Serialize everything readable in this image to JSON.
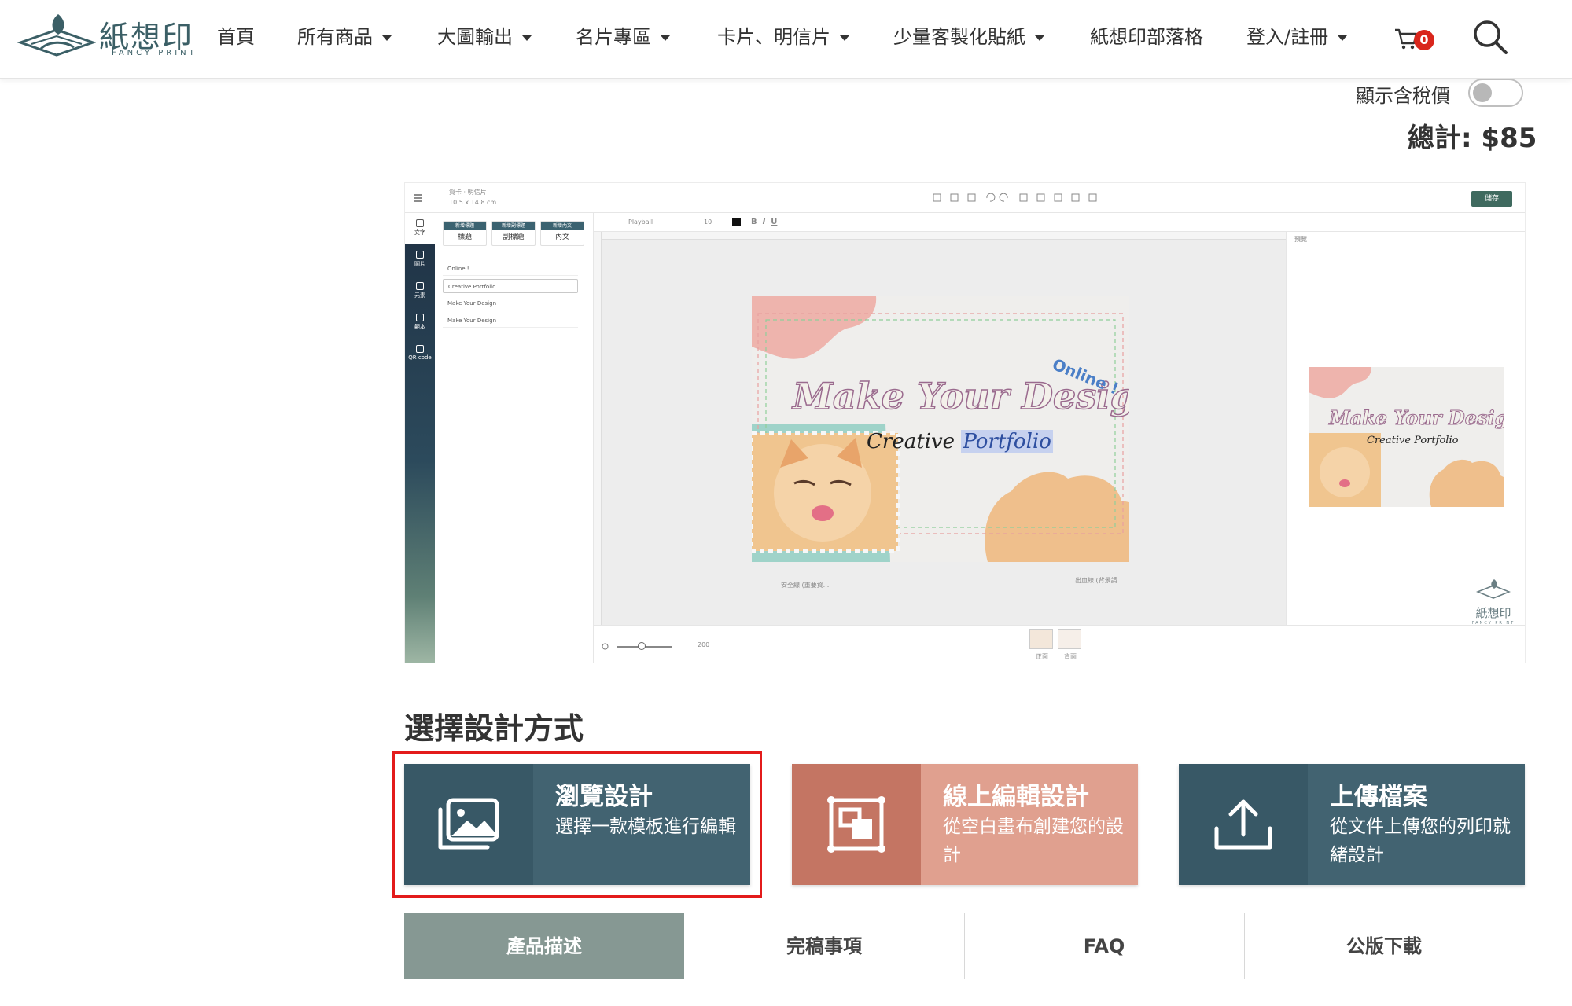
{
  "header": {
    "logo_text": "紙想印",
    "logo_sub": "FANCY PRINT",
    "nav": [
      {
        "label": "首頁",
        "dropdown": false
      },
      {
        "label": "所有商品",
        "dropdown": true
      },
      {
        "label": "大圖輸出",
        "dropdown": true
      },
      {
        "label": "名片專區",
        "dropdown": true
      },
      {
        "label": "卡片、明信片",
        "dropdown": true
      },
      {
        "label": "少量客製化貼紙",
        "dropdown": true
      },
      {
        "label": "紙想印部落格",
        "dropdown": false
      },
      {
        "label": "登入/註冊",
        "dropdown": true
      }
    ],
    "cart_count": "0"
  },
  "price": {
    "tax_toggle_label": "顯示含稅價",
    "tax_toggle_on": false,
    "total": "總計: $85"
  },
  "editor_preview": {
    "breadcrumb": "賀卡 · 明信片",
    "size": "10.5 x 14.8 cm",
    "save_label": "儲存",
    "rail": [
      "文字",
      "圖片",
      "元素",
      "範本",
      "QR code"
    ],
    "panel_buttons": [
      {
        "top": "新增標題",
        "label": "標題"
      },
      {
        "top": "新增副標題",
        "label": "副標題"
      },
      {
        "top": "新增內文",
        "label": "內文"
      }
    ],
    "layers": [
      "Online !",
      "Creative Portfolio",
      "Make Your Design",
      "Make Your Design"
    ],
    "font_name": "Playball",
    "font_size": "10",
    "preview_label": "預覽",
    "zoom": "200",
    "safe_line_label": "安全線 (重要資...",
    "bleed_line_label": "出血線 (背景請...",
    "pages": [
      "正面",
      "背面"
    ],
    "card_title": "Make Your Design",
    "card_sub_1": "Creative",
    "card_sub_2": "Portfolio",
    "card_online": "Online !",
    "watermark": "紙想印",
    "watermark_sub": "FANCY PRINT"
  },
  "design_section": {
    "title": "選擇設計方式",
    "options": [
      {
        "title": "瀏覽設計",
        "desc": "選擇一款模板進行編輯",
        "icon": "image-gallery-icon",
        "left_color": "#385866",
        "right_color": "#426371"
      },
      {
        "title": "線上編輯設計",
        "desc": "從空白畫布創建您的設計",
        "icon": "canvas-edit-icon",
        "left_color": "#c47563",
        "right_color": "#e0a08f"
      },
      {
        "title": "上傳檔案",
        "desc": "從文件上傳您的列印就緒設計",
        "icon": "upload-icon",
        "left_color": "#385866",
        "right_color": "#426371"
      }
    ],
    "highlight_color": "#e31b1b"
  },
  "tabs": [
    {
      "label": "產品描述",
      "active": true
    },
    {
      "label": "完稿事項",
      "active": false
    },
    {
      "label": "FAQ",
      "active": false
    },
    {
      "label": "公版下載",
      "active": false
    }
  ],
  "colors": {
    "brand": "#3b5f66",
    "tab_active": "#869893",
    "badge": "#d9261c"
  }
}
